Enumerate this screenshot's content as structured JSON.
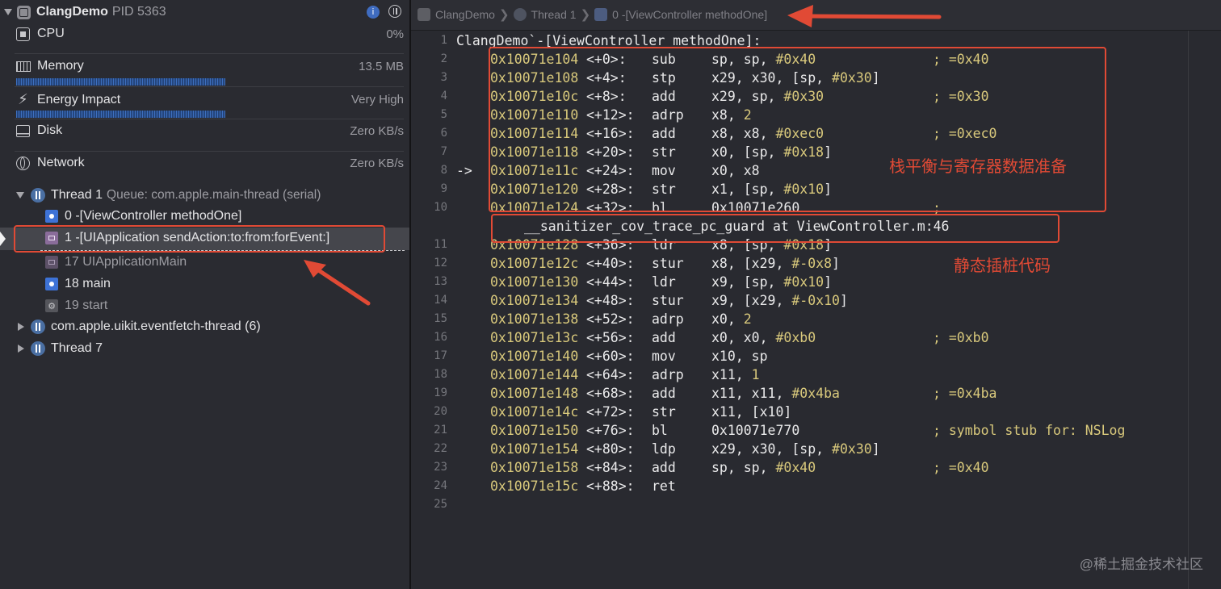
{
  "process": {
    "name": "ClangDemo",
    "pid": "PID 5363"
  },
  "gauges": [
    {
      "label": "CPU",
      "value": "0%"
    },
    {
      "label": "Memory",
      "value": "13.5 MB"
    },
    {
      "label": "Energy Impact",
      "value": "Very High"
    },
    {
      "label": "Disk",
      "value": "Zero KB/s"
    },
    {
      "label": "Network",
      "value": "Zero KB/s"
    }
  ],
  "thread1": {
    "name": "Thread 1",
    "queue": "Queue: com.apple.main-thread (serial)"
  },
  "frames": [
    "0 -[ViewController methodOne]",
    "1 -[UIApplication sendAction:to:from:forEvent:]",
    "17 UIApplicationMain",
    "18 main",
    "19 start"
  ],
  "other_threads": [
    "com.apple.uikit.eventfetch-thread (6)",
    "Thread 7"
  ],
  "jumpbar": [
    "ClangDemo",
    "Thread 1",
    "0 -[ViewController methodOne]"
  ],
  "code": {
    "header": "ClangDemo`-[ViewController methodOne]:",
    "current_marker": "->",
    "guard_line": "__sanitizer_cov_trace_pc_guard at ViewController.m:46",
    "lines": [
      {
        "ln": "1",
        "addr": "",
        "off": "",
        "op": "",
        "args": "",
        "cmt": ""
      },
      {
        "ln": "2",
        "addr": "0x10071e104",
        "off": "<+0>:",
        "op": "sub",
        "args": "sp, sp, #0x40",
        "cmt": "; =0x40"
      },
      {
        "ln": "3",
        "addr": "0x10071e108",
        "off": "<+4>:",
        "op": "stp",
        "args": "x29, x30, [sp, #0x30]",
        "cmt": ""
      },
      {
        "ln": "4",
        "addr": "0x10071e10c",
        "off": "<+8>:",
        "op": "add",
        "args": "x29, sp, #0x30",
        "cmt": "; =0x30"
      },
      {
        "ln": "5",
        "addr": "0x10071e110",
        "off": "<+12>:",
        "op": "adrp",
        "args": "x8, 2",
        "cmt": ""
      },
      {
        "ln": "6",
        "addr": "0x10071e114",
        "off": "<+16>:",
        "op": "add",
        "args": "x8, x8, #0xec0",
        "cmt": "; =0xec0"
      },
      {
        "ln": "7",
        "addr": "0x10071e118",
        "off": "<+20>:",
        "op": "str",
        "args": "x0, [sp, #0x18]",
        "cmt": ""
      },
      {
        "ln": "8",
        "addr": "0x10071e11c",
        "off": "<+24>:",
        "op": "mov",
        "args": "x0, x8",
        "cmt": ""
      },
      {
        "ln": "9",
        "addr": "0x10071e120",
        "off": "<+28>:",
        "op": "str",
        "args": "x1, [sp, #0x10]",
        "cmt": ""
      },
      {
        "ln": "10",
        "addr": "0x10071e124",
        "off": "<+32>:",
        "op": "bl",
        "args": "0x10071e260",
        "cmt": ";"
      },
      {
        "ln": "11",
        "addr": "0x10071e128",
        "off": "<+36>:",
        "op": "ldr",
        "args": "x8, [sp, #0x18]",
        "cmt": ""
      },
      {
        "ln": "12",
        "addr": "0x10071e12c",
        "off": "<+40>:",
        "op": "stur",
        "args": "x8, [x29, #-0x8]",
        "cmt": ""
      },
      {
        "ln": "13",
        "addr": "0x10071e130",
        "off": "<+44>:",
        "op": "ldr",
        "args": "x9, [sp, #0x10]",
        "cmt": ""
      },
      {
        "ln": "14",
        "addr": "0x10071e134",
        "off": "<+48>:",
        "op": "stur",
        "args": "x9, [x29, #-0x10]",
        "cmt": ""
      },
      {
        "ln": "15",
        "addr": "0x10071e138",
        "off": "<+52>:",
        "op": "adrp",
        "args": "x0, 2",
        "cmt": ""
      },
      {
        "ln": "16",
        "addr": "0x10071e13c",
        "off": "<+56>:",
        "op": "add",
        "args": "x0, x0, #0xb0",
        "cmt": "; =0xb0"
      },
      {
        "ln": "17",
        "addr": "0x10071e140",
        "off": "<+60>:",
        "op": "mov",
        "args": "x10, sp",
        "cmt": ""
      },
      {
        "ln": "18",
        "addr": "0x10071e144",
        "off": "<+64>:",
        "op": "adrp",
        "args": "x11, 1",
        "cmt": ""
      },
      {
        "ln": "19",
        "addr": "0x10071e148",
        "off": "<+68>:",
        "op": "add",
        "args": "x11, x11, #0x4ba",
        "cmt": "; =0x4ba"
      },
      {
        "ln": "20",
        "addr": "0x10071e14c",
        "off": "<+72>:",
        "op": "str",
        "args": "x11, [x10]",
        "cmt": ""
      },
      {
        "ln": "21",
        "addr": "0x10071e150",
        "off": "<+76>:",
        "op": "bl",
        "args": "0x10071e770",
        "cmt": "; symbol stub for: NSLog"
      },
      {
        "ln": "22",
        "addr": "0x10071e154",
        "off": "<+80>:",
        "op": "ldp",
        "args": "x29, x30, [sp, #0x30]",
        "cmt": ""
      },
      {
        "ln": "23",
        "addr": "0x10071e158",
        "off": "<+84>:",
        "op": "add",
        "args": "sp, sp, #0x40",
        "cmt": "; =0x40"
      },
      {
        "ln": "24",
        "addr": "0x10071e15c",
        "off": "<+88>:",
        "op": "ret",
        "args": "",
        "cmt": ""
      },
      {
        "ln": "25",
        "addr": "",
        "off": "",
        "op": "",
        "args": "",
        "cmt": ""
      }
    ]
  },
  "annotations": {
    "stack_note": "栈平衡与寄存器数据准备",
    "instrument_note": "静态插桩代码"
  },
  "watermark": "@稀土掘金技术社区",
  "colors": {
    "annotation_red": "#e14a35",
    "address_yellow": "#d9c97c",
    "thread_blue": "#4a6fa3"
  }
}
